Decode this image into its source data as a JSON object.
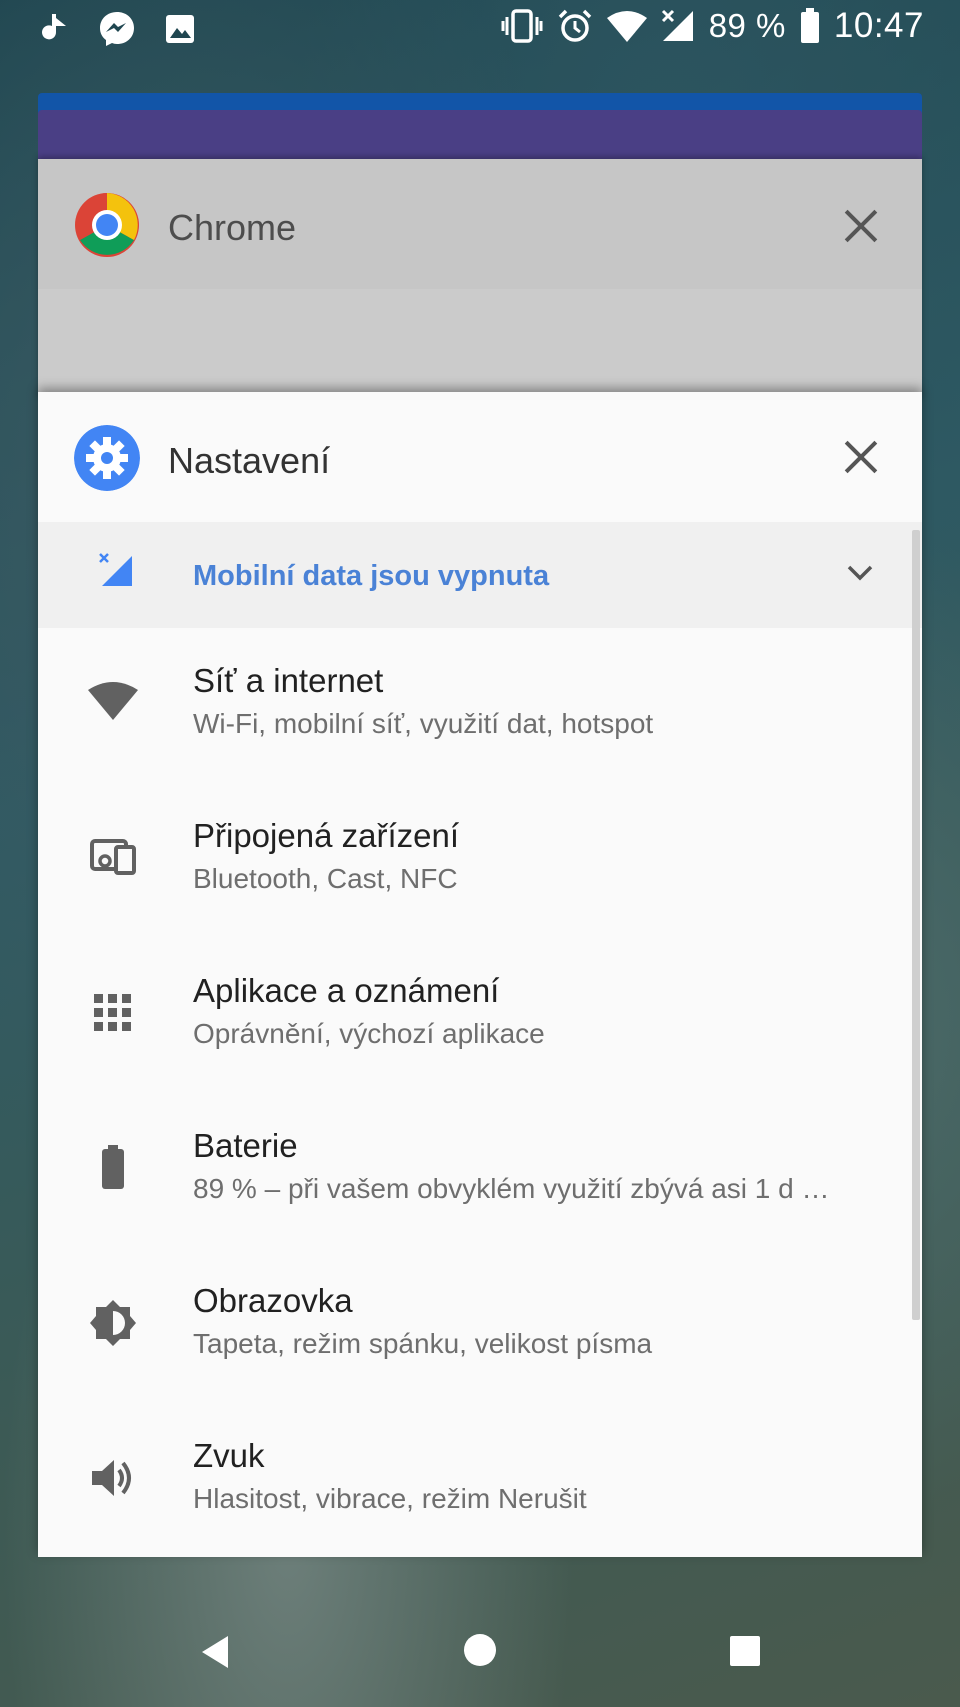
{
  "status_bar": {
    "battery_percent": "89 %",
    "time": "10:47"
  },
  "recents": {
    "chrome_card": {
      "title": "Chrome",
      "close_icon": "close-icon"
    },
    "settings_card": {
      "title": "Nastavení",
      "close_icon": "close-icon",
      "banner": {
        "label": "Mobilní data jsou vypnuta",
        "icon": "mobile-data-off-icon"
      },
      "items": [
        {
          "title": "Síť a internet",
          "subtitle": "Wi-Fi, mobilní síť, využití dat, hotspot",
          "icon": "wifi-icon"
        },
        {
          "title": "Připojená zařízení",
          "subtitle": "Bluetooth, Cast, NFC",
          "icon": "devices-icon"
        },
        {
          "title": "Aplikace a oznámení",
          "subtitle": "Oprávnění, výchozí aplikace",
          "icon": "apps-grid-icon"
        },
        {
          "title": "Baterie",
          "subtitle": "89 % – při vašem obvyklém využití zbývá asi 1 d …",
          "icon": "battery-icon"
        },
        {
          "title": "Obrazovka",
          "subtitle": "Tapeta, režim spánku, velikost písma",
          "icon": "brightness-icon"
        },
        {
          "title": "Zvuk",
          "subtitle": "Hlasitost, vibrace, režim Nerušit",
          "icon": "volume-icon"
        }
      ]
    }
  },
  "colors": {
    "accent": "#4a82d6",
    "settings_icon_bg": "#4285f4",
    "chrome_card_bg": "#cbcbcb"
  }
}
